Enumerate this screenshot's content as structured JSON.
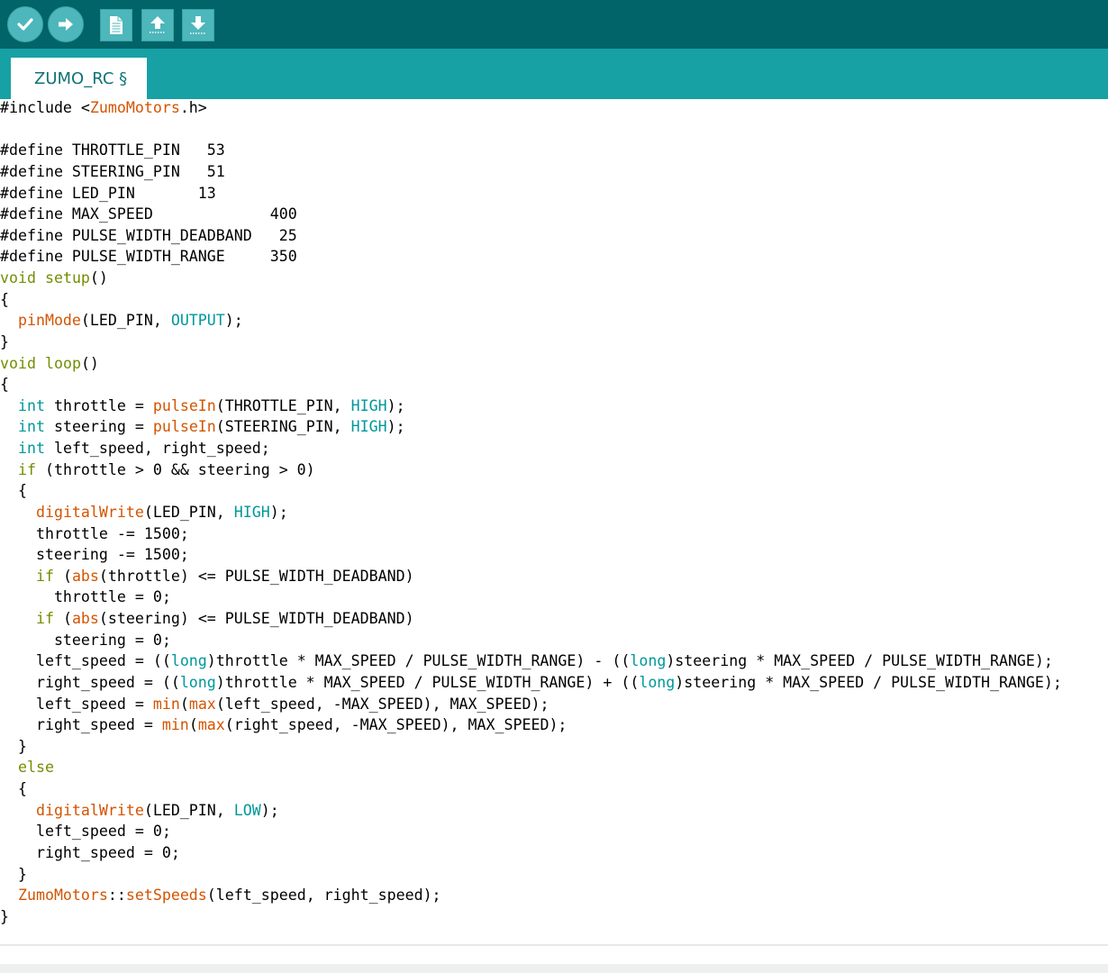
{
  "toolbar": {
    "buttons": [
      {
        "name": "verify",
        "icon": "checkmark-icon"
      },
      {
        "name": "upload",
        "icon": "arrow-right-icon"
      },
      {
        "name": "new",
        "icon": "new-file-icon"
      },
      {
        "name": "open",
        "icon": "open-upload-icon"
      },
      {
        "name": "save",
        "icon": "save-download-icon"
      }
    ]
  },
  "tabs": [
    {
      "label": "ZUMO_RC §",
      "active": true
    }
  ],
  "colors": {
    "toolbar_bg": "#006468",
    "tabbar_bg": "#17a1a5",
    "button_bg": "#4db7bb",
    "tab_text": "#0f7377",
    "keyword": "#728e00",
    "function": "#d35400",
    "constant": "#00979c"
  },
  "code_lines": [
    [
      [
        "#include <",
        ""
      ],
      [
        "ZumoMotors",
        "fn"
      ],
      [
        ".h>",
        ""
      ]
    ],
    [
      [
        "",
        ""
      ]
    ],
    [
      [
        "#define THROTTLE_PIN   53",
        ""
      ]
    ],
    [
      [
        "#define STEERING_PIN   51",
        ""
      ]
    ],
    [
      [
        "#define LED_PIN       13",
        ""
      ]
    ],
    [
      [
        "#define MAX_SPEED             400",
        ""
      ]
    ],
    [
      [
        "#define PULSE_WIDTH_DEADBAND   25",
        ""
      ]
    ],
    [
      [
        "#define PULSE_WIDTH_RANGE     350",
        ""
      ]
    ],
    [
      [
        "void",
        "kw"
      ],
      [
        " ",
        ""
      ],
      [
        "setup",
        "kw"
      ],
      [
        "()",
        ""
      ]
    ],
    [
      [
        "{",
        ""
      ]
    ],
    [
      [
        "  ",
        ""
      ],
      [
        "pinMode",
        "fn"
      ],
      [
        "(LED_PIN, ",
        ""
      ],
      [
        "OUTPUT",
        "cn"
      ],
      [
        ");",
        ""
      ]
    ],
    [
      [
        "}",
        ""
      ]
    ],
    [
      [
        "void",
        "kw"
      ],
      [
        " ",
        ""
      ],
      [
        "loop",
        "kw"
      ],
      [
        "()",
        ""
      ]
    ],
    [
      [
        "{",
        ""
      ]
    ],
    [
      [
        "  ",
        ""
      ],
      [
        "int",
        "cn"
      ],
      [
        " throttle = ",
        ""
      ],
      [
        "pulseIn",
        "fn"
      ],
      [
        "(THROTTLE_PIN, ",
        ""
      ],
      [
        "HIGH",
        "cn"
      ],
      [
        ");",
        ""
      ]
    ],
    [
      [
        "  ",
        ""
      ],
      [
        "int",
        "cn"
      ],
      [
        " steering = ",
        ""
      ],
      [
        "pulseIn",
        "fn"
      ],
      [
        "(STEERING_PIN, ",
        ""
      ],
      [
        "HIGH",
        "cn"
      ],
      [
        ");",
        ""
      ]
    ],
    [
      [
        "  ",
        ""
      ],
      [
        "int",
        "cn"
      ],
      [
        " left_speed, right_speed;",
        ""
      ]
    ],
    [
      [
        "  ",
        ""
      ],
      [
        "if",
        "kw"
      ],
      [
        " (throttle > 0 && steering > 0)",
        ""
      ]
    ],
    [
      [
        "  {",
        ""
      ]
    ],
    [
      [
        "    ",
        ""
      ],
      [
        "digitalWrite",
        "fn"
      ],
      [
        "(LED_PIN, ",
        ""
      ],
      [
        "HIGH",
        "cn"
      ],
      [
        ");",
        ""
      ]
    ],
    [
      [
        "    throttle -= 1500;",
        ""
      ]
    ],
    [
      [
        "    steering -= 1500;",
        ""
      ]
    ],
    [
      [
        "    ",
        ""
      ],
      [
        "if",
        "kw"
      ],
      [
        " (",
        ""
      ],
      [
        "abs",
        "fn"
      ],
      [
        "(throttle) <= PULSE_WIDTH_DEADBAND)",
        ""
      ]
    ],
    [
      [
        "      throttle = 0;",
        ""
      ]
    ],
    [
      [
        "    ",
        ""
      ],
      [
        "if",
        "kw"
      ],
      [
        " (",
        ""
      ],
      [
        "abs",
        "fn"
      ],
      [
        "(steering) <= PULSE_WIDTH_DEADBAND)",
        ""
      ]
    ],
    [
      [
        "      steering = 0;",
        ""
      ]
    ],
    [
      [
        "    left_speed = ((",
        ""
      ],
      [
        "long",
        "cn"
      ],
      [
        ")throttle * MAX_SPEED / PULSE_WIDTH_RANGE) - ((",
        ""
      ],
      [
        "long",
        "cn"
      ],
      [
        ")steering * MAX_SPEED / PULSE_WIDTH_RANGE);",
        ""
      ]
    ],
    [
      [
        "    right_speed = ((",
        ""
      ],
      [
        "long",
        "cn"
      ],
      [
        ")throttle * MAX_SPEED / PULSE_WIDTH_RANGE) + ((",
        ""
      ],
      [
        "long",
        "cn"
      ],
      [
        ")steering * MAX_SPEED / PULSE_WIDTH_RANGE);",
        ""
      ]
    ],
    [
      [
        "    left_speed = ",
        ""
      ],
      [
        "min",
        "fn"
      ],
      [
        "(",
        ""
      ],
      [
        "max",
        "fn"
      ],
      [
        "(left_speed, -MAX_SPEED), MAX_SPEED);",
        ""
      ]
    ],
    [
      [
        "    right_speed = ",
        ""
      ],
      [
        "min",
        "fn"
      ],
      [
        "(",
        ""
      ],
      [
        "max",
        "fn"
      ],
      [
        "(right_speed, -MAX_SPEED), MAX_SPEED);",
        ""
      ]
    ],
    [
      [
        "  }",
        ""
      ]
    ],
    [
      [
        "  ",
        ""
      ],
      [
        "else",
        "kw"
      ]
    ],
    [
      [
        "  {",
        ""
      ]
    ],
    [
      [
        "    ",
        ""
      ],
      [
        "digitalWrite",
        "fn"
      ],
      [
        "(LED_PIN, ",
        ""
      ],
      [
        "LOW",
        "cn"
      ],
      [
        ");",
        ""
      ]
    ],
    [
      [
        "    left_speed = 0;",
        ""
      ]
    ],
    [
      [
        "    right_speed = 0;",
        ""
      ]
    ],
    [
      [
        "  }",
        ""
      ]
    ],
    [
      [
        "  ",
        ""
      ],
      [
        "ZumoMotors",
        "fn"
      ],
      [
        "::",
        ""
      ],
      [
        "setSpeeds",
        "fn"
      ],
      [
        "(left_speed, right_speed);",
        ""
      ]
    ],
    [
      [
        "}",
        ""
      ]
    ]
  ]
}
